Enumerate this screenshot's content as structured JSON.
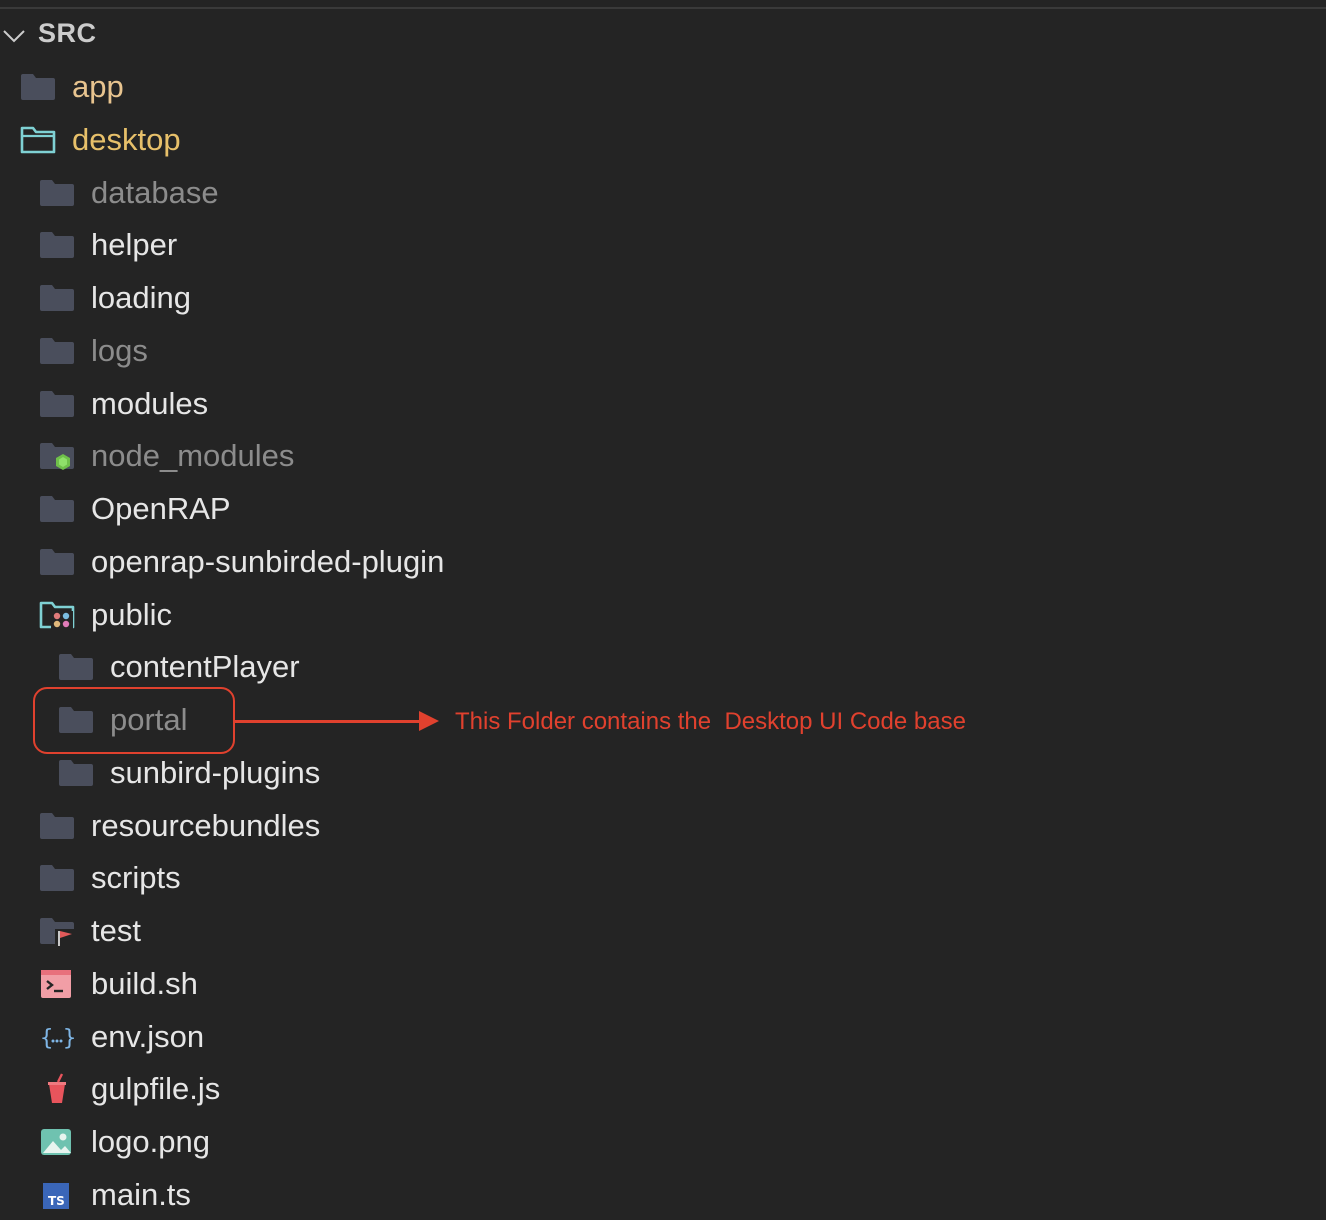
{
  "explorer": {
    "section_title": "SRC",
    "items": [
      {
        "label": "app",
        "type": "folder",
        "depth": 0,
        "style": "orange"
      },
      {
        "label": "desktop",
        "type": "folder-open",
        "depth": 0,
        "style": "yellow"
      },
      {
        "label": "database",
        "type": "folder",
        "depth": 1,
        "style": "dim"
      },
      {
        "label": "helper",
        "type": "folder",
        "depth": 1,
        "style": "normal"
      },
      {
        "label": "loading",
        "type": "folder",
        "depth": 1,
        "style": "normal"
      },
      {
        "label": "logs",
        "type": "folder",
        "depth": 1,
        "style": "dim"
      },
      {
        "label": "modules",
        "type": "folder",
        "depth": 1,
        "style": "normal"
      },
      {
        "label": "node_modules",
        "type": "folder-node",
        "depth": 1,
        "style": "dim"
      },
      {
        "label": "OpenRAP",
        "type": "folder",
        "depth": 1,
        "style": "normal"
      },
      {
        "label": "openrap-sunbirded-plugin",
        "type": "folder",
        "depth": 1,
        "style": "normal"
      },
      {
        "label": "public",
        "type": "folder-public",
        "depth": 1,
        "style": "normal"
      },
      {
        "label": "contentPlayer",
        "type": "folder",
        "depth": 2,
        "style": "normal"
      },
      {
        "label": "portal",
        "type": "folder",
        "depth": 2,
        "style": "dim"
      },
      {
        "label": "sunbird-plugins",
        "type": "folder",
        "depth": 2,
        "style": "normal"
      },
      {
        "label": "resourcebundles",
        "type": "folder",
        "depth": 1,
        "style": "normal"
      },
      {
        "label": "scripts",
        "type": "folder",
        "depth": 1,
        "style": "normal"
      },
      {
        "label": "test",
        "type": "folder-test",
        "depth": 1,
        "style": "normal"
      },
      {
        "label": "build.sh",
        "type": "file-shell",
        "depth": 1,
        "style": "normal"
      },
      {
        "label": "env.json",
        "type": "file-json",
        "depth": 1,
        "style": "normal"
      },
      {
        "label": "gulpfile.js",
        "type": "file-gulp",
        "depth": 1,
        "style": "normal"
      },
      {
        "label": "logo.png",
        "type": "file-image",
        "depth": 1,
        "style": "normal"
      },
      {
        "label": "main.ts",
        "type": "file-ts",
        "depth": 1,
        "style": "normal"
      }
    ]
  },
  "annotation": {
    "text": "This Folder contains the  Desktop UI Code base",
    "color": "#e0412e"
  },
  "colors": {
    "background": "#242424",
    "folder_icon": "#4a4e5c",
    "open_folder_icon": "#7fd1d4",
    "annotation": "#e0412e"
  }
}
